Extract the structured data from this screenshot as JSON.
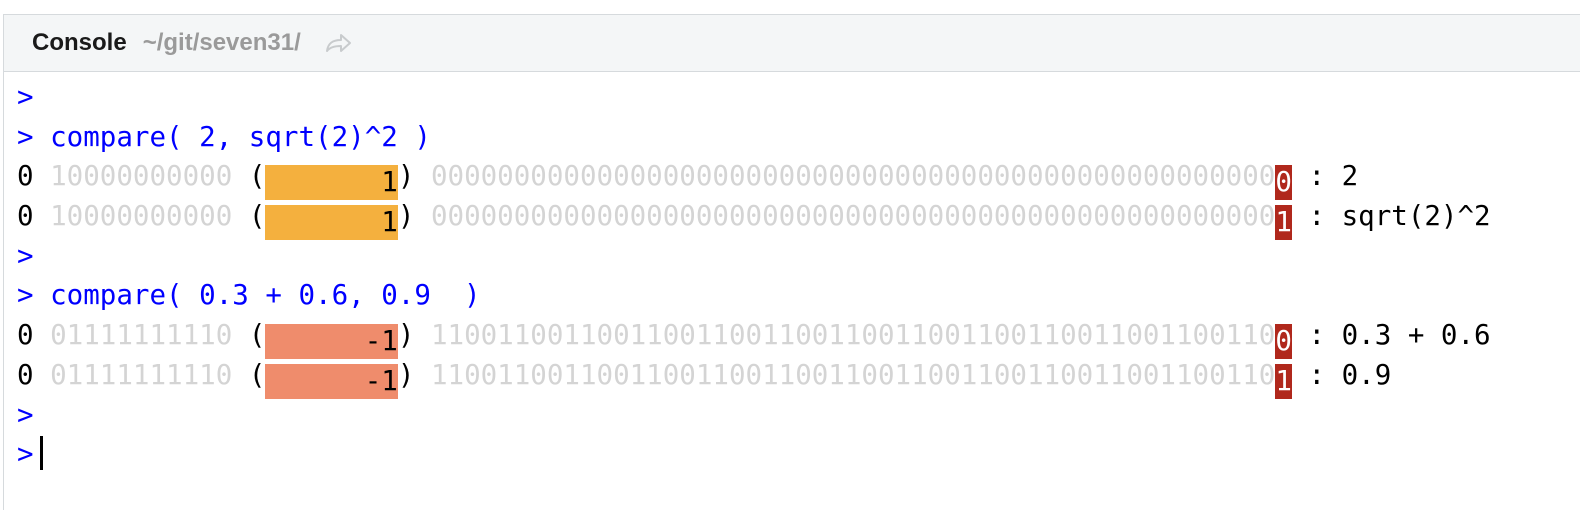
{
  "header": {
    "title": "Console",
    "path": "~/git/seven31/",
    "goto_icon": "go-to-directory-arrow-icon"
  },
  "console": {
    "prompt": ">",
    "commands": [
      "compare( 2, sqrt(2)^2 )",
      "compare( 0.3 + 0.6, 0.9  )"
    ],
    "outputs": [
      {
        "sign": "0",
        "exponent_bits": "10000000000",
        "open_paren": "(",
        "exponent_value": "       1",
        "close_paren": ")",
        "mantissa_bits": "000000000000000000000000000000000000000000000000000",
        "diff_bit": "0",
        "separator": ":",
        "label": "2"
      },
      {
        "sign": "0",
        "exponent_bits": "10000000000",
        "open_paren": "(",
        "exponent_value": "       1",
        "close_paren": ")",
        "mantissa_bits": "000000000000000000000000000000000000000000000000000",
        "diff_bit": "1",
        "separator": ":",
        "label": "sqrt(2)^2"
      },
      {
        "sign": "0",
        "exponent_bits": "01111111110",
        "open_paren": "(",
        "exponent_value": "      -1",
        "close_paren": ")",
        "mantissa_bits": "110011001100110011001100110011001100110011001100110",
        "diff_bit": "0",
        "separator": ":",
        "label": "0.3 + 0.6"
      },
      {
        "sign": "0",
        "exponent_bits": "01111111110",
        "open_paren": "(",
        "exponent_value": "      -1",
        "close_paren": ")",
        "mantissa_bits": "110011001100110011001100110011001100110011001100110",
        "diff_bit": "1",
        "separator": ":",
        "label": "0.9"
      }
    ]
  },
  "colors": {
    "prompt": "#0000ff",
    "muted_bits": "#d4d4d4",
    "exponent_positive": "#f4b03e",
    "exponent_negative": "#ef8c6c",
    "diff_bit": "#b0281c"
  }
}
